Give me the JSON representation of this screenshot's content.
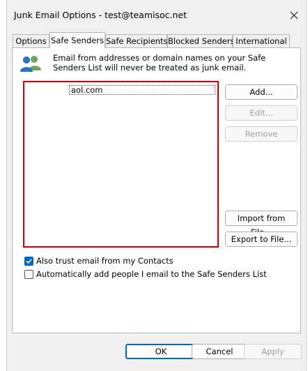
{
  "window": {
    "title": "Junk Email Options - test@teamisoc.net"
  },
  "tabs": [
    {
      "label": "Options"
    },
    {
      "label": "Safe Senders"
    },
    {
      "label": "Safe Recipients"
    },
    {
      "label": "Blocked Senders"
    },
    {
      "label": "International"
    }
  ],
  "panel": {
    "description": "Email from addresses or domain names on your Safe Senders List will never be treated as junk email.",
    "list": [
      "aol.com"
    ],
    "buttons": {
      "add": "Add...",
      "edit": "Edit...",
      "remove": "Remove",
      "import": "Import from File...",
      "export": "Export to File..."
    },
    "options": {
      "trust_contacts": {
        "label": "Also trust email from my Contacts",
        "checked": true
      },
      "auto_add": {
        "label": "Automatically add people I email to the Safe Senders List",
        "checked": false
      }
    }
  },
  "footer": {
    "ok": "OK",
    "cancel": "Cancel",
    "apply": "Apply"
  },
  "colors": {
    "highlight_border": "#d40000",
    "checkbox_accent": "#0067c0"
  },
  "icons": {
    "panel": "people-icon",
    "close": "close-icon",
    "checkmark": "checkmark-icon"
  }
}
